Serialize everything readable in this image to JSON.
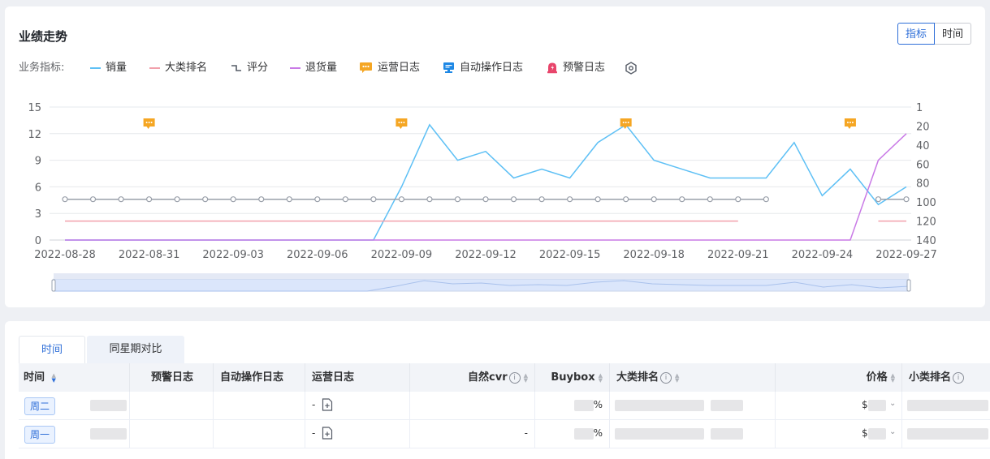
{
  "trend": {
    "title": "业绩走势",
    "toggle": {
      "metric": "指标",
      "time": "时间",
      "active": "metric"
    },
    "legend_label": "业务指标:",
    "legend": [
      {
        "label": "销量",
        "color": "#5ec0f5",
        "kind": "line"
      },
      {
        "label": "大类排名",
        "color": "#f1a0ab",
        "kind": "line"
      },
      {
        "label": "评分",
        "color": "#555b66",
        "kind": "step"
      },
      {
        "label": "退货量",
        "color": "#c97ae6",
        "kind": "line"
      },
      {
        "label": "运营日志",
        "color": "#f5a623",
        "kind": "chat-icon"
      },
      {
        "label": "自动操作日志",
        "color": "#1e88e5",
        "kind": "monitor-icon"
      },
      {
        "label": "预警日志",
        "color": "#e8456b",
        "kind": "alarm-icon"
      }
    ],
    "settings_icon": "settings-icon"
  },
  "chart_data": {
    "type": "line",
    "x": [
      "2022-08-28",
      "2022-08-29",
      "2022-08-30",
      "2022-08-31",
      "2022-09-01",
      "2022-09-02",
      "2022-09-03",
      "2022-09-04",
      "2022-09-05",
      "2022-09-06",
      "2022-09-07",
      "2022-09-08",
      "2022-09-09",
      "2022-09-10",
      "2022-09-11",
      "2022-09-12",
      "2022-09-13",
      "2022-09-14",
      "2022-09-15",
      "2022-09-16",
      "2022-09-17",
      "2022-09-18",
      "2022-09-19",
      "2022-09-20",
      "2022-09-21",
      "2022-09-22",
      "2022-09-23",
      "2022-09-24",
      "2022-09-25",
      "2022-09-26",
      "2022-09-27"
    ],
    "x_tick_labels": [
      "2022-08-28",
      "2022-08-31",
      "2022-09-03",
      "2022-09-06",
      "2022-09-09",
      "2022-09-12",
      "2022-09-15",
      "2022-09-18",
      "2022-09-21",
      "2022-09-24",
      "2022-09-27"
    ],
    "y_left": {
      "ticks": [
        0,
        3,
        6,
        9,
        12,
        15
      ],
      "range": [
        0,
        15
      ]
    },
    "y_right": {
      "ticks": [
        1,
        20,
        40,
        60,
        80,
        100,
        120,
        140
      ],
      "range": [
        1,
        140
      ],
      "inverted": true
    },
    "series": [
      {
        "name": "销量",
        "axis": "left",
        "color": "#5ec0f5",
        "values": [
          0,
          0,
          0,
          0,
          0,
          0,
          0,
          0,
          0,
          0,
          0,
          0,
          6,
          13,
          9,
          10,
          7,
          8,
          7,
          11,
          13,
          9,
          8,
          7,
          7,
          7,
          11,
          5,
          8,
          4,
          6
        ]
      },
      {
        "name": "退货量",
        "axis": "left",
        "color": "#c97ae6",
        "values": [
          0,
          0,
          0,
          0,
          0,
          0,
          0,
          0,
          0,
          0,
          0,
          0,
          0,
          0,
          0,
          0,
          0,
          0,
          0,
          0,
          0,
          0,
          0,
          0,
          0,
          0,
          0,
          0,
          0,
          9,
          12
        ]
      },
      {
        "name": "大类排名",
        "axis": "right",
        "color": "#f1a0ab",
        "values": [
          120,
          120,
          120,
          120,
          120,
          120,
          120,
          120,
          120,
          120,
          120,
          120,
          120,
          120,
          120,
          120,
          120,
          120,
          120,
          120,
          120,
          120,
          120,
          120,
          120,
          null,
          null,
          null,
          null,
          120,
          120
        ]
      },
      {
        "name": "评分",
        "axis": "left",
        "color": "#9aa0aa",
        "markers": true,
        "values": [
          4.6,
          4.6,
          4.6,
          4.6,
          4.6,
          4.6,
          4.6,
          4.6,
          4.6,
          4.6,
          4.6,
          4.6,
          4.6,
          4.6,
          4.6,
          4.6,
          4.6,
          4.6,
          4.6,
          4.6,
          4.6,
          4.6,
          4.6,
          4.6,
          4.6,
          4.6,
          null,
          null,
          null,
          4.6,
          4.6
        ]
      }
    ],
    "ops_log_dates": [
      "2022-08-31",
      "2022-09-09",
      "2022-09-17",
      "2022-09-25"
    ],
    "grid": true,
    "zoom_slider": true
  },
  "table": {
    "tabs": [
      {
        "label": "时间",
        "active": true
      },
      {
        "label": "同星期对比",
        "active": false
      }
    ],
    "columns": [
      {
        "label": "时间",
        "sort": "desc"
      },
      {
        "label": "预警日志"
      },
      {
        "label": "自动操作日志"
      },
      {
        "label": "运营日志"
      },
      {
        "label": "自然cvr",
        "info": true,
        "sort": "none"
      },
      {
        "label": "Buybox",
        "sort": "none"
      },
      {
        "label": "大类排名",
        "info": true,
        "sort": "none"
      },
      {
        "label": "价格",
        "sort": "none"
      },
      {
        "label": "小类排名",
        "info": true
      }
    ],
    "rows": [
      {
        "weekday": "周二",
        "ops_log": "-",
        "cvr": "",
        "buybox": "%",
        "price": "$"
      },
      {
        "weekday": "周一",
        "ops_log": "-",
        "cvr": "-",
        "buybox": "%",
        "price": "$"
      }
    ]
  }
}
